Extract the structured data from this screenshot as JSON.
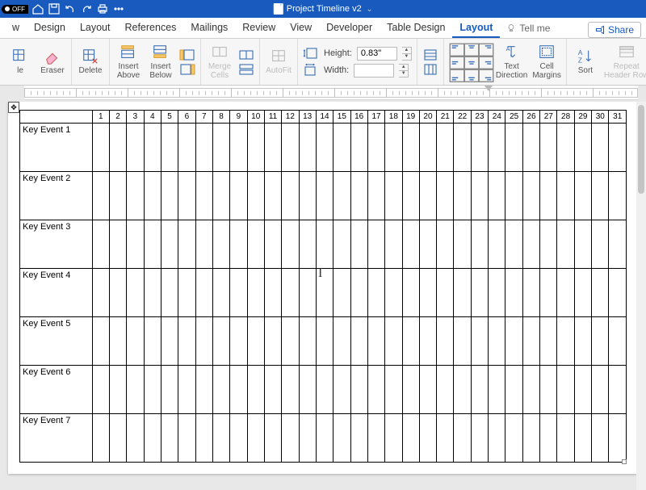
{
  "titlebar": {
    "autoswitch": "OFF",
    "doc_title": "Project Timeline v2"
  },
  "menu": {
    "items": [
      "w",
      "Design",
      "Layout",
      "References",
      "Mailings",
      "Review",
      "View",
      "Developer",
      "Table Design",
      "Layout"
    ],
    "active_index": 9,
    "tell_me": "Tell me",
    "share": "Share"
  },
  "ribbon": {
    "draw_suffix": "le",
    "eraser": "Eraser",
    "delete": "Delete",
    "insert_above": "Insert\nAbove",
    "insert_below": "Insert\nBelow",
    "merge_cells": "Merge\nCells",
    "autofit": "AutoFit",
    "height_label": "Height:",
    "height_value": "0.83\"",
    "width_label": "Width:",
    "width_value": "",
    "text_direction": "Text\nDirection",
    "cell_margins": "Cell\nMargins",
    "sort": "Sort",
    "repeat_header": "Repeat\nHeader Row"
  },
  "table": {
    "days": [
      "1",
      "2",
      "3",
      "4",
      "5",
      "6",
      "7",
      "8",
      "9",
      "10",
      "11",
      "12",
      "13",
      "14",
      "15",
      "16",
      "17",
      "18",
      "19",
      "20",
      "21",
      "22",
      "23",
      "24",
      "25",
      "26",
      "27",
      "28",
      "29",
      "30",
      "31"
    ],
    "rows": [
      "Key Event 1",
      "Key Event 2",
      "Key Event 3",
      "Key Event 4",
      "Key Event 5",
      "Key Event 6",
      "Key Event 7"
    ]
  }
}
